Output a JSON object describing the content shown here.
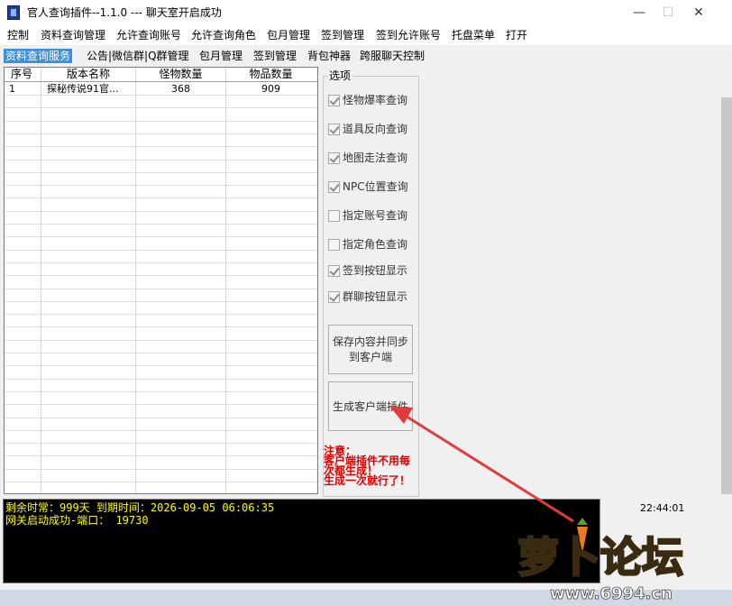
{
  "window": {
    "title": "官人查询插件--1.1.0 --- 聊天室开启成功",
    "minimize_glyph": "—",
    "maximize_glyph": "☐",
    "close_glyph": "✕"
  },
  "menu": [
    "控制",
    "资料查询管理",
    "允许查询账号",
    "允许查询角色",
    "包月管理",
    "签到管理",
    "签到允许账号",
    "托盘菜单",
    "打开"
  ],
  "tabs": [
    "资料查询服务",
    "公告|微信群|Q群管理",
    "包月管理",
    "签到管理",
    "背包神器",
    "跨服聊天控制"
  ],
  "table": {
    "headers": [
      "序号",
      "版本名称",
      "怪物数量",
      "物品数量"
    ],
    "rows": [
      [
        "1",
        "探秘传说91官...",
        "368",
        "909"
      ]
    ]
  },
  "options": {
    "title": "选项",
    "items": [
      {
        "label": "怪物爆率查询",
        "checked": true
      },
      {
        "label": "道具反向查询",
        "checked": true
      },
      {
        "label": "地图走法查询",
        "checked": true
      },
      {
        "label": "NPC位置查询",
        "checked": true
      },
      {
        "label": "指定账号查询",
        "checked": false
      },
      {
        "label": "指定角色查询",
        "checked": false
      },
      {
        "label": "签到按钮显示",
        "checked": true
      },
      {
        "label": "群聊按钮显示",
        "checked": true
      }
    ],
    "save_button": [
      "保存内容并同步",
      "到客户端"
    ],
    "generate_button": "生成客户端插件",
    "note": [
      "注意：",
      "客户端插件不用每",
      "次都生成！",
      "生成一次就行了！"
    ]
  },
  "log": [
    "剩余时常：999天 到期时间：2026-09-05 06:06:35",
    "网关启动成功-端口： 19730"
  ],
  "clock": "22:44:01",
  "watermark": {
    "logo_text": "萝卜论坛",
    "url": "www.6994.cn"
  },
  "colors": {
    "active_tab": "#3c8fd8",
    "log_text": "#ffff00",
    "note": "#e00000",
    "arrow": "#e23b3b"
  }
}
